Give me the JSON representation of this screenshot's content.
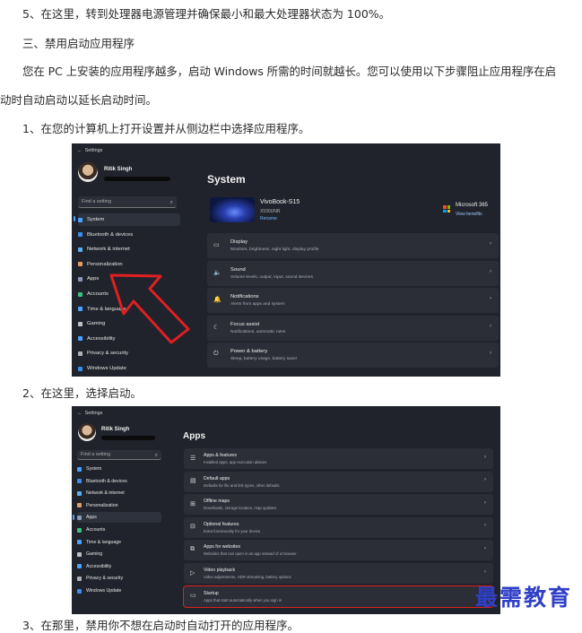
{
  "paragraphs": {
    "p1": "5、在这里，转到处理器电源管理并确保最小和最大处理器状态为 100%。",
    "p2": "三、禁用启动应用程序",
    "p3a": "您在 PC 上安装的应用程序越多，启动 Windows 所需的时间就越长。您可以使用以下步骤阻止应用程序在启",
    "p3b": "动时自动启动以延长启动时间。",
    "p4": "1、在您的计算机上打开设置并从侧边栏中选择应用程序。",
    "p5": "2、在这里，选择启动。",
    "p6": "3、在那里，禁用你不想在启动时自动打开的应用程序。"
  },
  "shot1": {
    "window_title": "Settings",
    "user_name": "Ritik Singh",
    "search_placeholder": "Find a setting",
    "page_title": "System",
    "device_name": "VivoBook-S15",
    "device_model": "X530UNR",
    "rename_link": "Rename",
    "ms365_title": "Microsoft 365",
    "ms365_link": "View benefits",
    "nav": [
      {
        "label": "System",
        "color": "#4aa3ff"
      },
      {
        "label": "Bluetooth & devices",
        "color": "#3a8eea"
      },
      {
        "label": "Network & internet",
        "color": "#5ab0f0"
      },
      {
        "label": "Personalization",
        "color": "#e0a060"
      },
      {
        "label": "Apps",
        "color": "#8a9ab8"
      },
      {
        "label": "Accounts",
        "color": "#3fbf7f"
      },
      {
        "label": "Time & language",
        "color": "#4aa3ff"
      },
      {
        "label": "Gaming",
        "color": "#c0c0c0"
      },
      {
        "label": "Accessibility",
        "color": "#4aa3ff"
      },
      {
        "label": "Privacy & security",
        "color": "#b0b0b0"
      },
      {
        "label": "Windows Update",
        "color": "#3a8eea"
      }
    ],
    "cards": [
      {
        "title": "Display",
        "sub": "Monitors, brightness, night light, display profile",
        "icon": "▭"
      },
      {
        "title": "Sound",
        "sub": "Volume levels, output, input, sound devices",
        "icon": "🔈"
      },
      {
        "title": "Notifications",
        "sub": "Alerts from apps and system",
        "icon": "🔔"
      },
      {
        "title": "Focus assist",
        "sub": "Notifications, automatic rules",
        "icon": "☾"
      },
      {
        "title": "Power & battery",
        "sub": "Sleep, battery usage, battery saver",
        "icon": "⏻"
      }
    ]
  },
  "shot2": {
    "window_title": "Settings",
    "user_name": "Ritik Singh",
    "search_placeholder": "Find a setting",
    "page_title": "Apps",
    "nav": [
      {
        "label": "System",
        "color": "#4aa3ff"
      },
      {
        "label": "Bluetooth & devices",
        "color": "#3a8eea"
      },
      {
        "label": "Network & internet",
        "color": "#5ab0f0"
      },
      {
        "label": "Personalization",
        "color": "#e0a060"
      },
      {
        "label": "Apps",
        "color": "#8a9ab8"
      },
      {
        "label": "Accounts",
        "color": "#3fbf7f"
      },
      {
        "label": "Time & language",
        "color": "#4aa3ff"
      },
      {
        "label": "Gaming",
        "color": "#c0c0c0"
      },
      {
        "label": "Accessibility",
        "color": "#4aa3ff"
      },
      {
        "label": "Privacy & security",
        "color": "#b0b0b0"
      },
      {
        "label": "Windows Update",
        "color": "#3a8eea"
      }
    ],
    "cards": [
      {
        "title": "Apps & features",
        "sub": "Installed apps, app execution aliases",
        "icon": "☰"
      },
      {
        "title": "Default apps",
        "sub": "Defaults for file and link types, other defaults",
        "icon": "▤"
      },
      {
        "title": "Offline maps",
        "sub": "Downloads, storage location, map updates",
        "icon": "⊞"
      },
      {
        "title": "Optional features",
        "sub": "Extra functionality for your device",
        "icon": "⊟"
      },
      {
        "title": "Apps for websites",
        "sub": "Websites that can open in an app instead of a browser",
        "icon": "⧉"
      },
      {
        "title": "Video playback",
        "sub": "Video adjustments, HDR streaming, battery options",
        "icon": "▷"
      },
      {
        "title": "Startup",
        "sub": "Apps that start automatically when you sign in",
        "icon": "▭"
      }
    ]
  },
  "watermark": "最需教育",
  "colors": {
    "highlight_red": "#e02020",
    "watermark_blue": "#2f3fc8"
  }
}
